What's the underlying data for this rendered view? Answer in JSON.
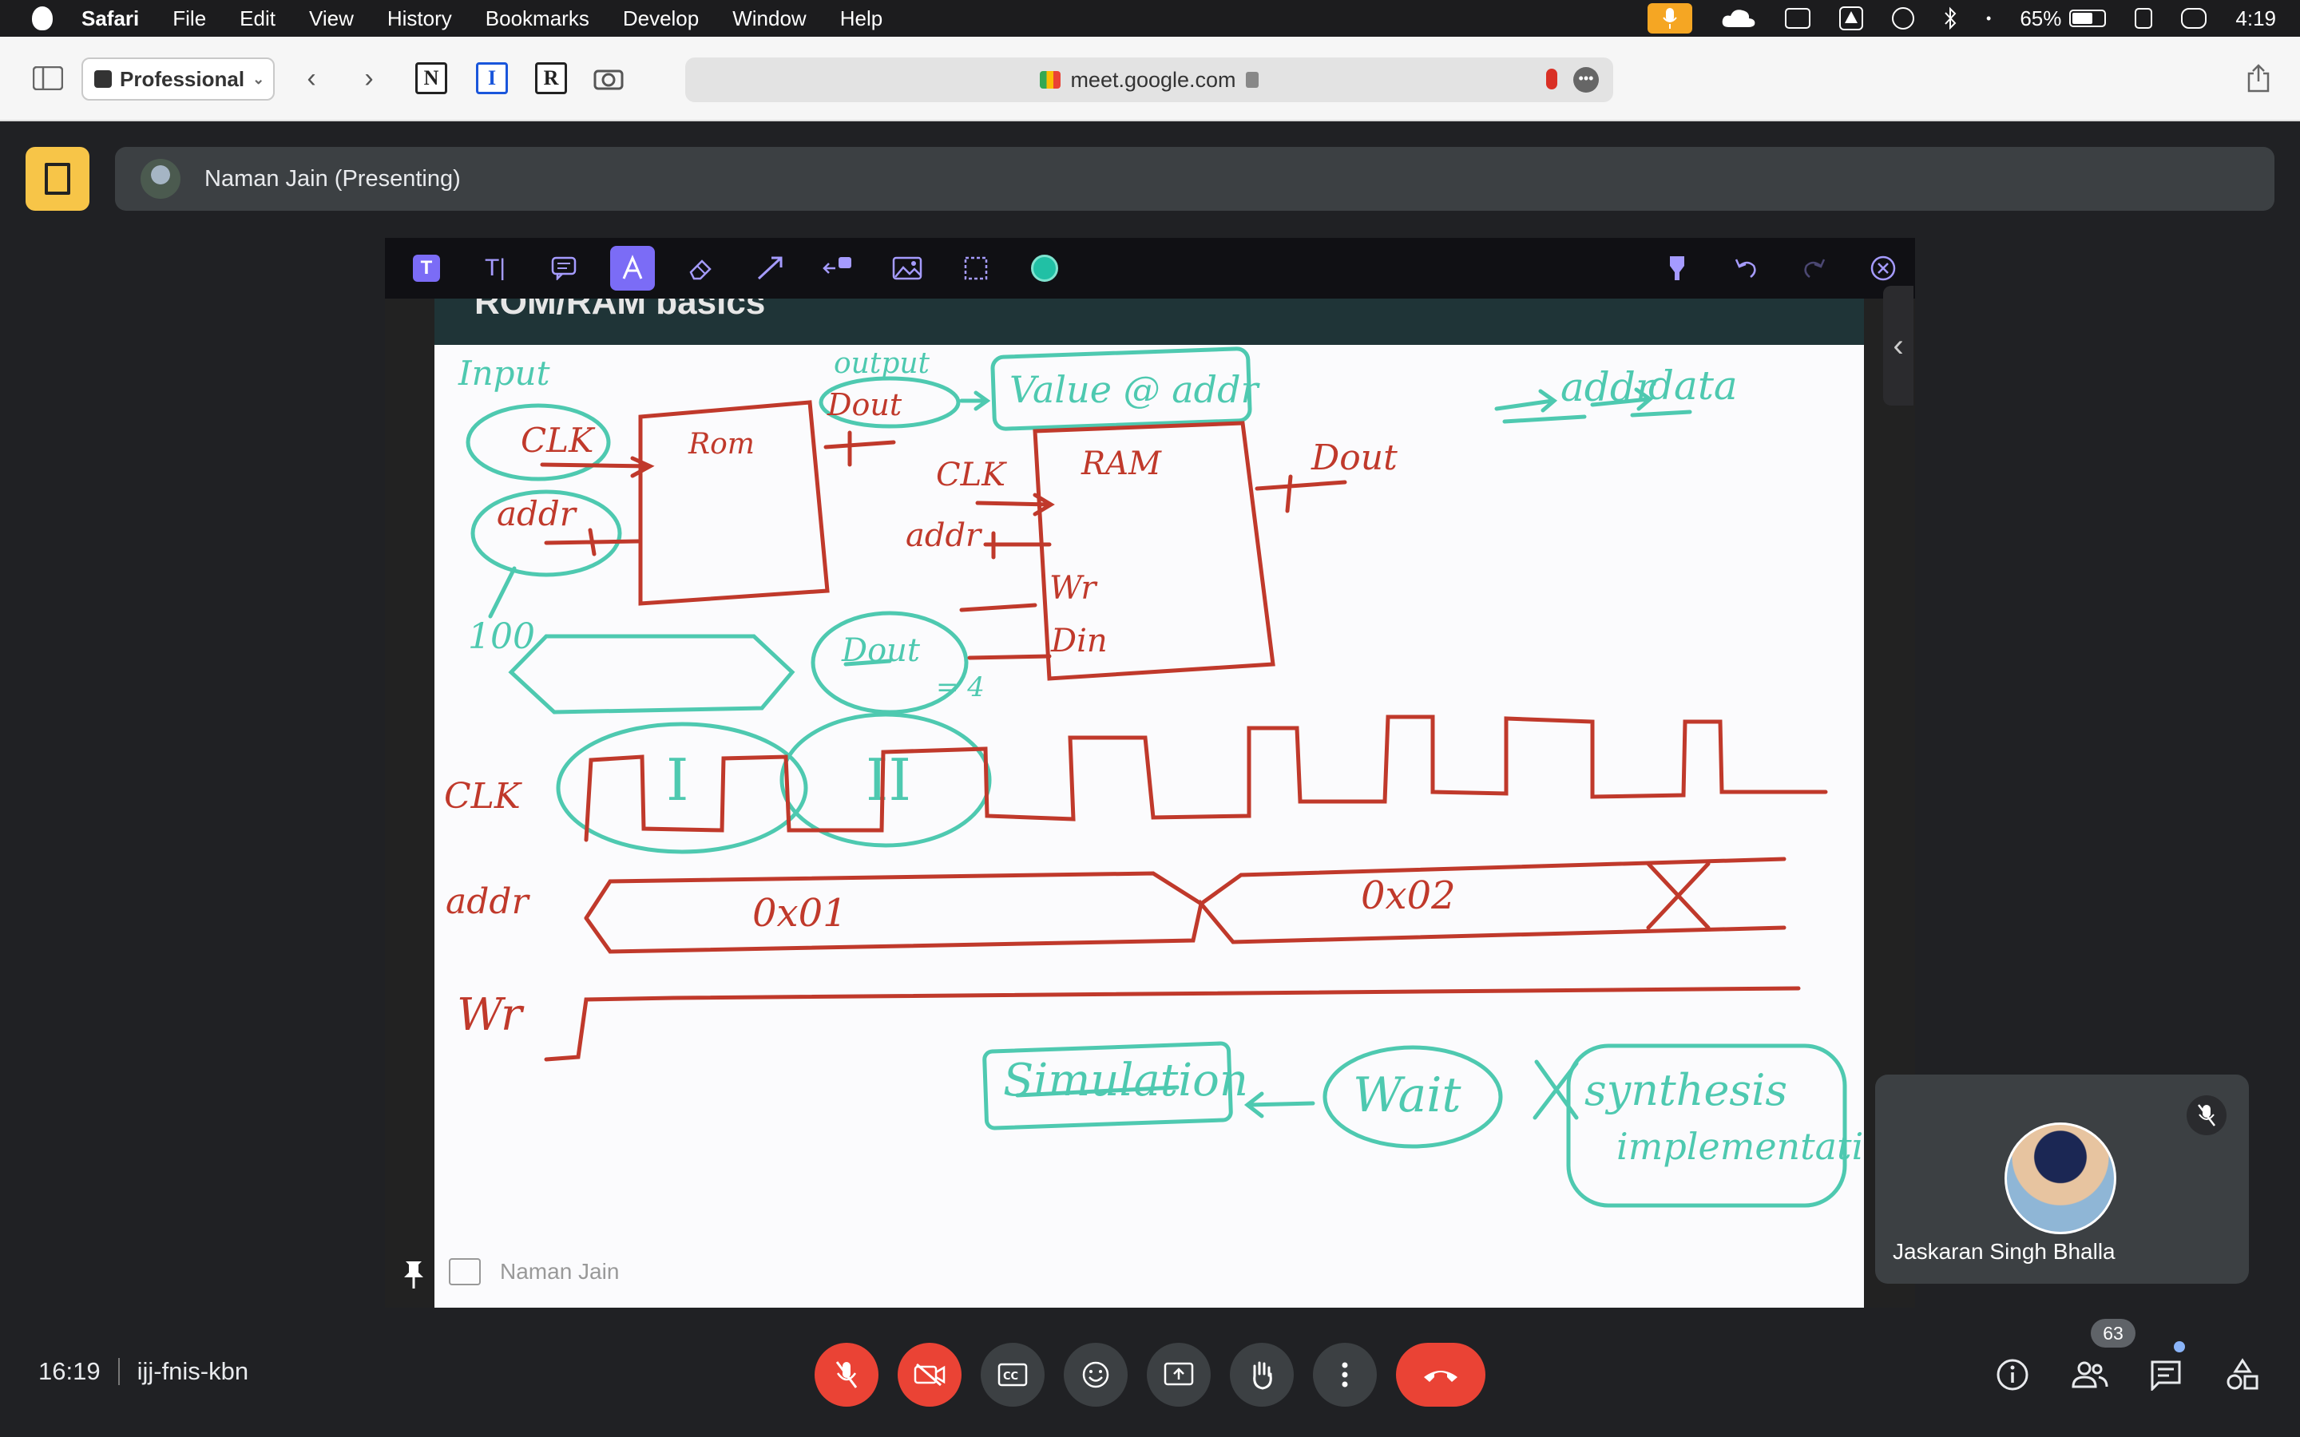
{
  "menubar": {
    "app": "Safari",
    "items": [
      "File",
      "Edit",
      "View",
      "History",
      "Bookmarks",
      "Develop",
      "Window",
      "Help"
    ],
    "battery": "65%",
    "battery_level": 0.65,
    "time": "4:19"
  },
  "browser": {
    "profile": "Professional",
    "url": "meet.google.com",
    "extensions": [
      "N",
      "I",
      "R"
    ]
  },
  "meet": {
    "presenter_label": "Naman Jain (Presenting)",
    "slide_title": "ROM/RAM basics",
    "presenter_name_tag": "Naman Jain",
    "participant_name": "Jaskaran Singh Bhalla",
    "time": "16:19",
    "meeting_code": "ijj-fnis-kbn",
    "participant_count": "63",
    "whiteboard": {
      "input_label": "Input",
      "output_label": "output",
      "clk": "CLK",
      "addr": "addr",
      "rom": "Rom",
      "ram": "RAM",
      "dout": "Dout",
      "value_addr": "Value @ addr",
      "addr_to_data_addr": "addr",
      "addr_to_data_data": "data",
      "wr": "Wr",
      "din": "Din",
      "hundred": "100",
      "dout_eq": "= 4",
      "roman1": "I",
      "roman2": "II",
      "x01": "0x01",
      "x02": "0x02",
      "simulation": "Simulation",
      "wait": "Wait",
      "synthesis": "synthesis",
      "implementation": "implementation"
    }
  },
  "colors": {
    "red_ink": "#c0392b",
    "teal_ink": "#4ec9b0",
    "end_call": "#ea4335"
  }
}
